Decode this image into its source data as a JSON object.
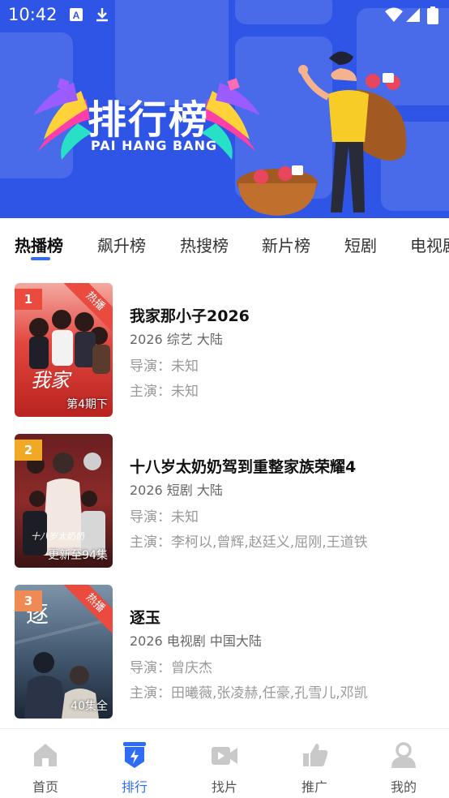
{
  "status_bar": {
    "time": "10:42"
  },
  "banner": {
    "title": "排行榜",
    "subtitle": "PAI HANG BANG",
    "colors": {
      "background": "#2f55e6"
    }
  },
  "tabs": [
    {
      "label": "热播榜",
      "active": true
    },
    {
      "label": "飙升榜",
      "active": false
    },
    {
      "label": "热搜榜",
      "active": false
    },
    {
      "label": "新片榜",
      "active": false
    },
    {
      "label": "短剧",
      "active": false
    },
    {
      "label": "电视剧",
      "active": false
    }
  ],
  "list": [
    {
      "rank": "1",
      "rank_color": "#ea4b3e",
      "badge": "热播",
      "poster_caption": "第4期下",
      "title": "我家那小子2026",
      "meta": "2026  综艺  大陆",
      "director": "导演：未知",
      "cast": "主演：未知"
    },
    {
      "rank": "2",
      "rank_color": "#f0a825",
      "badge": "",
      "poster_caption": "更新至94集",
      "title": "十八岁太奶奶驾到重整家族荣耀4",
      "meta": "2026  短剧  大陆",
      "director": "导演：未知",
      "cast": "主演：李柯以,曾辉,赵廷义,屈刚,王道铁"
    },
    {
      "rank": "3",
      "rank_color": "#f08a55",
      "badge": "热播",
      "poster_caption": "40集全",
      "title": "逐玉",
      "meta": "2026  电视剧  中国大陆",
      "director": "导演：曾庆杰",
      "cast": "主演：田曦薇,张凌赫,任豪,孔雪儿,邓凯"
    }
  ],
  "bottom_nav": [
    {
      "label": "首页",
      "icon": "home-icon",
      "active": false
    },
    {
      "label": "排行",
      "icon": "ranking-icon",
      "active": true
    },
    {
      "label": "找片",
      "icon": "video-camera-icon",
      "active": false
    },
    {
      "label": "推广",
      "icon": "thumbs-up-icon",
      "active": false
    },
    {
      "label": "我的",
      "icon": "user-icon",
      "active": false
    }
  ],
  "colors": {
    "accent": "#2d6cf6",
    "hot_ribbon": "#ea4b3e"
  }
}
